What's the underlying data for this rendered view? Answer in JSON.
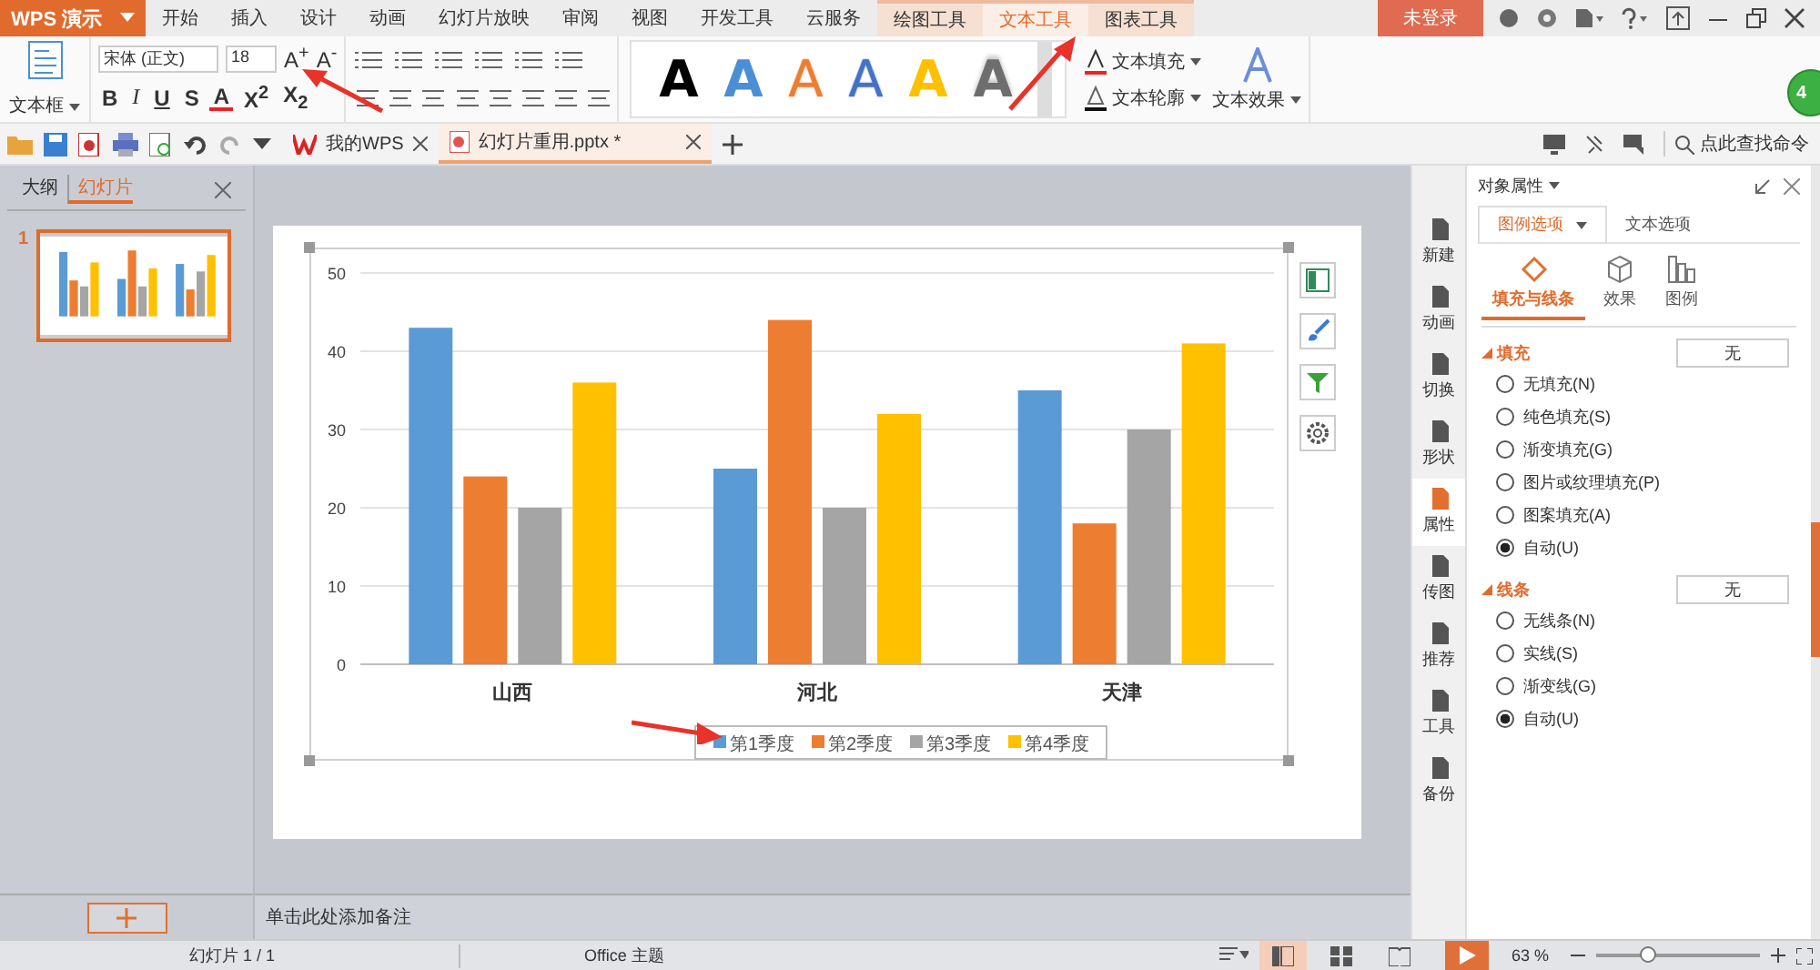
{
  "app_bar": {
    "logo": "WPS 演示",
    "login": "未登录"
  },
  "menu_tabs": [
    {
      "label": "开始",
      "selected": false,
      "kind": "normal"
    },
    {
      "label": "插入",
      "selected": false,
      "kind": "normal"
    },
    {
      "label": "设计",
      "selected": false,
      "kind": "normal"
    },
    {
      "label": "动画",
      "selected": false,
      "kind": "normal"
    },
    {
      "label": "幻灯片放映",
      "selected": false,
      "kind": "normal"
    },
    {
      "label": "审阅",
      "selected": false,
      "kind": "normal"
    },
    {
      "label": "视图",
      "selected": false,
      "kind": "normal"
    },
    {
      "label": "开发工具",
      "selected": false,
      "kind": "normal"
    },
    {
      "label": "云服务",
      "selected": false,
      "kind": "normal"
    },
    {
      "label": "绘图工具",
      "selected": false,
      "kind": "context"
    },
    {
      "label": "文本工具",
      "selected": true,
      "kind": "context"
    },
    {
      "label": "图表工具",
      "selected": false,
      "kind": "context"
    }
  ],
  "ribbon": {
    "text_box": "文本框",
    "font_family": "宋体 (正文)",
    "font_size": "18",
    "grow_font": "A$^{+}$",
    "shrink_font": "A$^{-}$",
    "format_buttons": [
      "B",
      "I",
      "U",
      "S",
      "A",
      "X$^{2}$",
      "X$_{2}$"
    ],
    "text_styles": [
      {
        "letter": "A",
        "color": "#000000",
        "kind": "fill"
      },
      {
        "letter": "A",
        "color": "#4a8fd6",
        "kind": "fill"
      },
      {
        "letter": "A",
        "color": "#ed7d31",
        "kind": "outline"
      },
      {
        "letter": "A",
        "color": "#4472c4",
        "kind": "outline"
      },
      {
        "letter": "A",
        "color": "#ffc000",
        "kind": "fill"
      },
      {
        "letter": "A",
        "color": "#6e6e6e",
        "kind": "gradient"
      }
    ],
    "text_fill": "文本填充",
    "text_outline": "文本轮廓",
    "text_effect": "文本效果"
  },
  "doc_tabs": [
    {
      "label": "我的WPS",
      "selected": false
    },
    {
      "label": "幻灯片重用.pptx *",
      "selected": true
    }
  ],
  "search": {
    "placeholder": "点此查找命令"
  },
  "badge": "4",
  "outline_panel": {
    "tabs": [
      {
        "label": "大纲",
        "selected": false
      },
      {
        "label": "幻灯片",
        "selected": true
      }
    ],
    "slides": [
      {
        "number": "1",
        "selected": true
      }
    ]
  },
  "chart": {
    "chart_data": {
      "type": "bar",
      "categories": [
        "山西",
        "河北",
        "天津"
      ],
      "series": [
        {
          "name": "第1季度",
          "color": "#5b9bd5",
          "values": [
            43,
            25,
            35
          ]
        },
        {
          "name": "第2季度",
          "color": "#ed7d31",
          "values": [
            24,
            44,
            18
          ]
        },
        {
          "name": "第3季度",
          "color": "#a5a5a5",
          "values": [
            20,
            20,
            30
          ]
        },
        {
          "name": "第4季度",
          "color": "#ffc000",
          "values": [
            36,
            32,
            41
          ]
        }
      ],
      "ylim": [
        0,
        50
      ],
      "yticks": [
        0,
        10,
        20,
        30,
        40,
        50
      ],
      "grid": true,
      "legend": true
    }
  },
  "notes": {
    "placeholder": "单击此处添加备注"
  },
  "sidebar": [
    {
      "label": "新建",
      "selected": false
    },
    {
      "label": "动画",
      "selected": false
    },
    {
      "label": "切换",
      "selected": false
    },
    {
      "label": "形状",
      "selected": false
    },
    {
      "label": "属性",
      "selected": true
    },
    {
      "label": "传图",
      "selected": false
    },
    {
      "label": "推荐",
      "selected": false
    },
    {
      "label": "工具",
      "selected": false
    },
    {
      "label": "备份",
      "selected": false
    }
  ],
  "properties": {
    "title": "对象属性",
    "tabs": [
      {
        "label": "图例选项",
        "selected": true
      },
      {
        "label": "文本选项",
        "selected": false
      }
    ],
    "subtabs": [
      {
        "label": "填充与线条",
        "selected": true
      },
      {
        "label": "效果",
        "selected": false
      },
      {
        "label": "图例",
        "selected": false
      }
    ],
    "sections": [
      {
        "title": "填充",
        "value": "无",
        "options": [
          {
            "label": "无填充(N)",
            "selected": false
          },
          {
            "label": "纯色填充(S)",
            "selected": false
          },
          {
            "label": "渐变填充(G)",
            "selected": false
          },
          {
            "label": "图片或纹理填充(P)",
            "selected": false
          },
          {
            "label": "图案填充(A)",
            "selected": false
          },
          {
            "label": "自动(U)",
            "selected": true
          }
        ]
      },
      {
        "title": "线条",
        "value": "无",
        "options": [
          {
            "label": "无线条(N)",
            "selected": false
          },
          {
            "label": "实线(S)",
            "selected": false
          },
          {
            "label": "渐变线(G)",
            "selected": false
          },
          {
            "label": "自动(U)",
            "selected": true
          }
        ]
      }
    ]
  },
  "status_bar": {
    "slide": "幻灯片 1 / 1",
    "theme": "Office 主题",
    "zoom": "63 %",
    "zoom_slider": {
      "level": 0.31
    }
  }
}
